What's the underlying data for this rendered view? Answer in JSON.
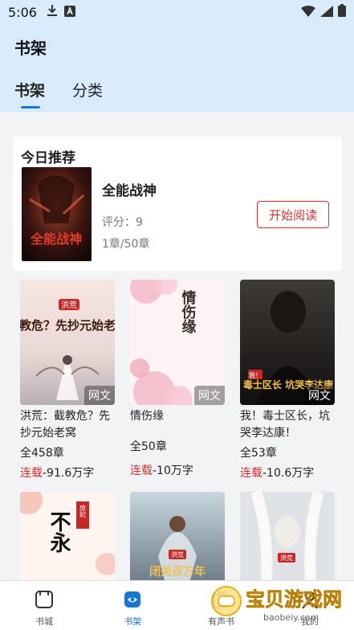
{
  "status_bar": {
    "time": "5:06"
  },
  "header": {
    "title": "书架",
    "tabs": [
      {
        "label": "书架",
        "active": true
      },
      {
        "label": "分类",
        "active": false
      }
    ]
  },
  "recommendation": {
    "heading": "今日推荐",
    "book": {
      "title": "全能战神",
      "score": "评分：9",
      "chapters": "1章/50章",
      "cover_text": "全能战神"
    },
    "action_label": "开始阅读"
  },
  "books": [
    {
      "name": "洪荒：截教危？先抄元始老窝",
      "chapters": "全458章",
      "status": "连载",
      "words": "-91.6万字",
      "tag": "网文",
      "cover_text": "截教危？先抄元始老窝",
      "cover_badge": "洪荒"
    },
    {
      "name": "情伤缘",
      "chapters": "全50章",
      "status": "连载",
      "words": "-10万字",
      "tag": "网文",
      "cover_text": "情伤缘"
    },
    {
      "name": "我！毒士区长，坑哭李达康！",
      "chapters": "全53章",
      "status": "连载",
      "words": "-10.6万字",
      "tag": "网文",
      "cover_text": "毒士区长 坑哭李达康",
      "cover_badge": "我！"
    },
    {
      "name": "",
      "tag": "",
      "cover_text": "不永",
      "cover_badge": "庶妃"
    },
    {
      "name": "",
      "tag": "",
      "cover_text": "闭关百万年",
      "cover_badge": "洪荒"
    },
    {
      "name": "",
      "tag": "",
      "cover_text": "",
      "cover_badge": "洪荒"
    }
  ],
  "bottom_nav": [
    {
      "label": "书城",
      "active": false
    },
    {
      "label": "书架",
      "active": true
    },
    {
      "label": "有声书",
      "active": false
    },
    {
      "label": "我的",
      "active": false
    }
  ],
  "watermark": {
    "text": "宝贝游戏网",
    "url": "baobeiy.com"
  },
  "colors": {
    "accent": "#1976d2",
    "serial_red": "#d32f2f",
    "header_bg": "#d8ebfb"
  }
}
